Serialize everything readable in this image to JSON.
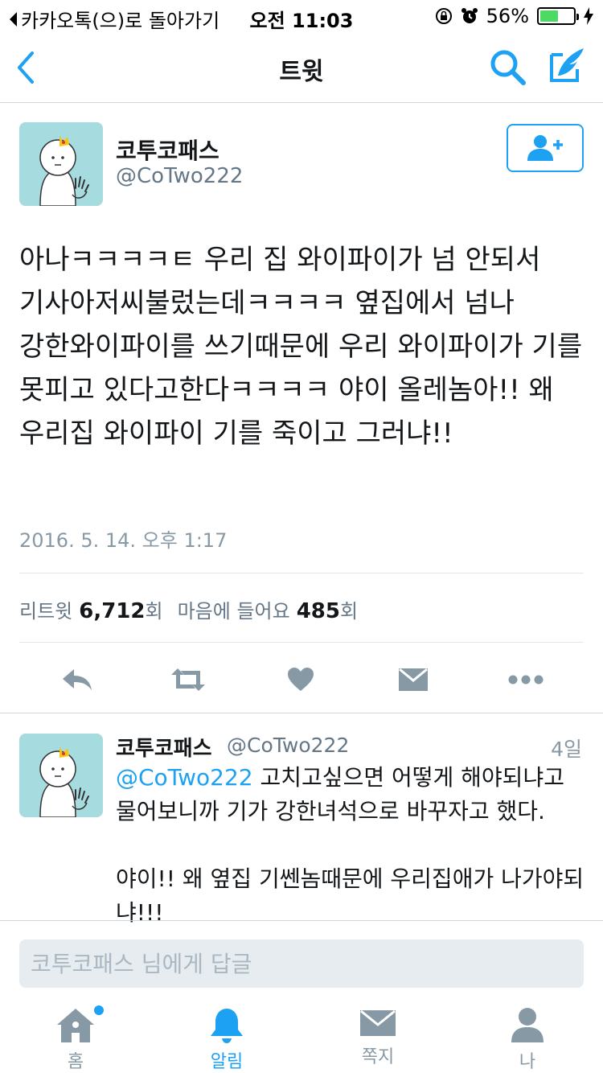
{
  "status_bar": {
    "back_app": "카카오톡(으)로 돌아가기",
    "time": "오전 11:03",
    "battery": "56%",
    "battery_level": 0.56
  },
  "nav": {
    "title": "트윗",
    "icons": {
      "back": "chevron-left-icon",
      "search": "search-icon",
      "compose": "compose-tweet-icon"
    }
  },
  "tweet": {
    "author_name": "코투코패스",
    "author_handle": "@CoTwo222",
    "text": "아나ㅋㅋㅋㅋㅌ 우리 집 와이파이가 넘 안되서 기사아저씨불렀는데ㅋㅋㅋㅋ 옆집에서 넘나 강한와이파이를 쓰기때문에 우리 와이파이가 기를 못피고 있다고한다ㅋㅋㅋㅋ 야이 올레놈아!! 왜 우리집 와이파이 기를 죽이고 그러냐!!",
    "timestamp": "2016. 5. 14. 오후 1:17",
    "retweet_label": "리트윗",
    "retweet_count": "6,712",
    "retweet_unit": "회",
    "like_label": "마음에 들어요",
    "like_count": "485",
    "like_unit": "회"
  },
  "reply": {
    "author_name": "코투코패스",
    "author_handle": "@CoTwo222",
    "time": "4일",
    "mention": "@CoTwo222",
    "text_1": " 고치고싶으면 어떻게 해야되냐고 물어보니까 기가 강한녀석으로 바꾸자고 했다.",
    "text_2": "야이!! 왜 옆집 기쎈놈때문에 우리집애가 나가야되냐!!!"
  },
  "reply_box": {
    "placeholder": "코투코패스 님에게 답글"
  },
  "tabs": [
    {
      "label": "홈",
      "icon": "home-icon"
    },
    {
      "label": "알림",
      "icon": "bell-icon"
    },
    {
      "label": "쪽지",
      "icon": "envelope-icon"
    },
    {
      "label": "나",
      "icon": "person-icon"
    }
  ],
  "colors": {
    "accent": "#1da1f2",
    "icon_gray": "#8899a6",
    "avatar_bg": "#a6dce0"
  }
}
